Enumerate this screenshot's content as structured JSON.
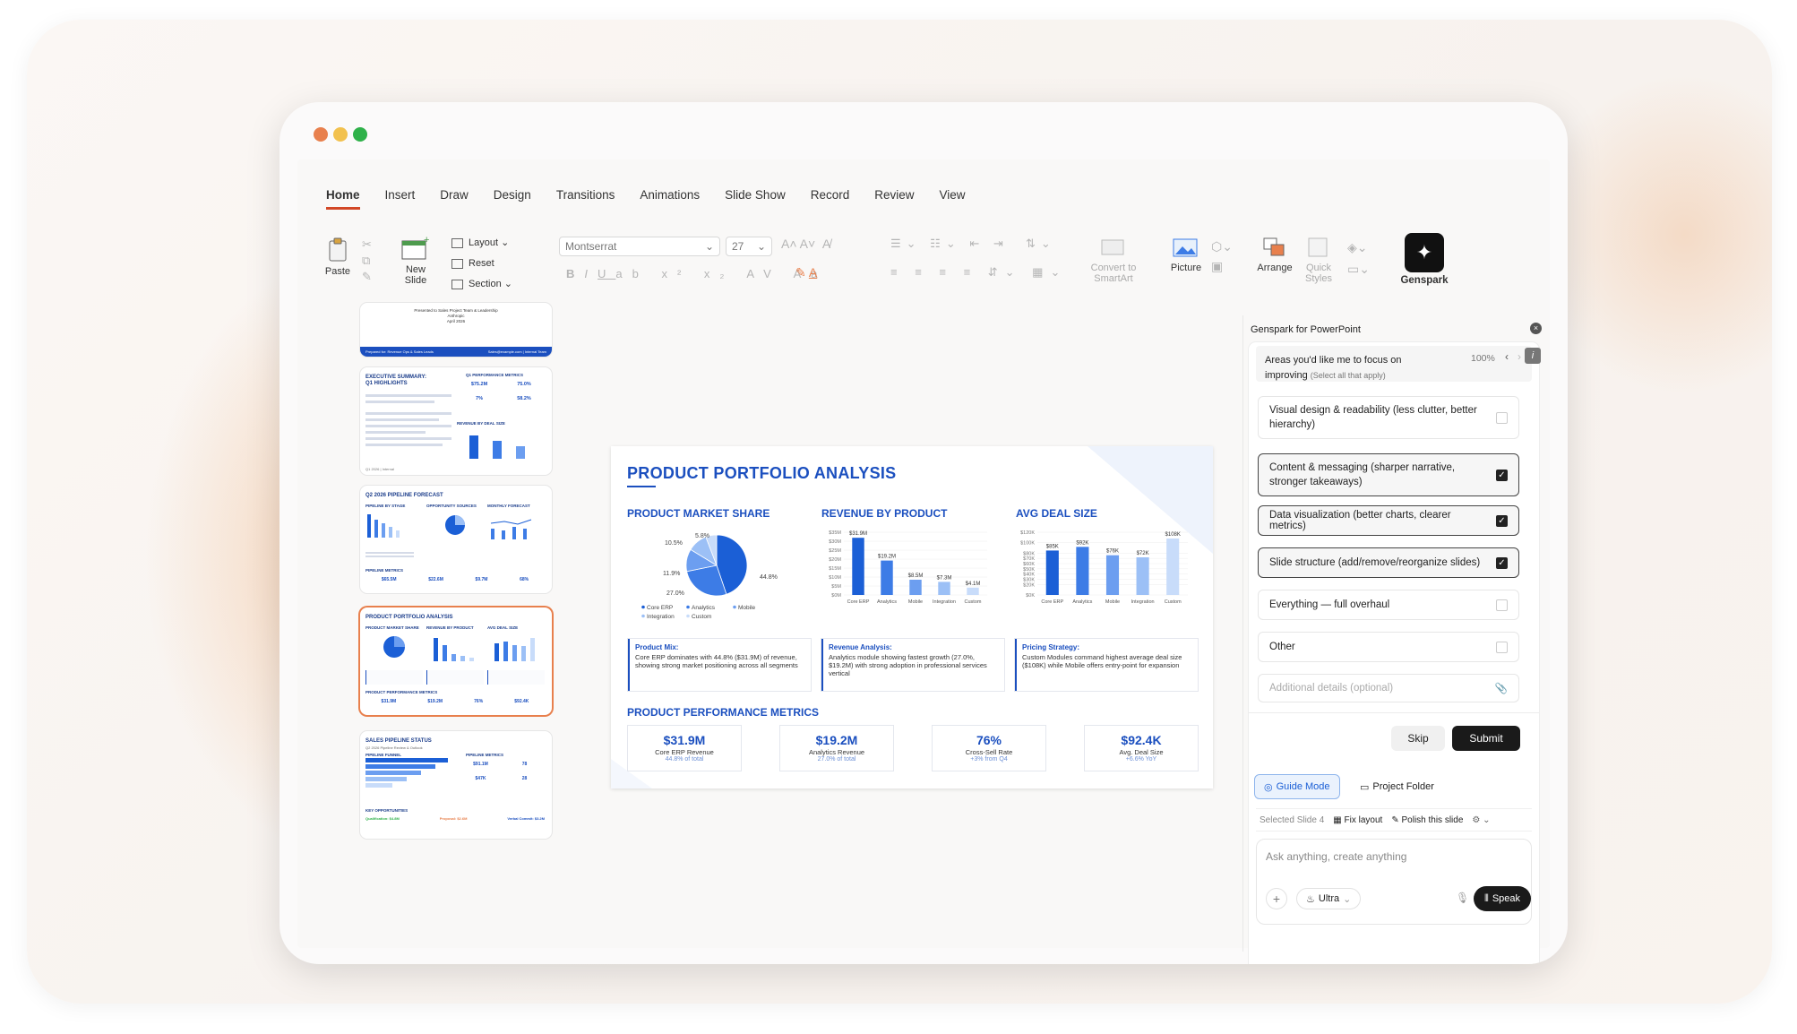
{
  "window": {
    "dots": [
      "#e8804d",
      "#f2c14e",
      "#2fb14a"
    ]
  },
  "tabs": [
    "Home",
    "Insert",
    "Draw",
    "Design",
    "Transitions",
    "Animations",
    "Slide Show",
    "Record",
    "Review",
    "View"
  ],
  "ribbon": {
    "paste": "Paste",
    "new_slide_1": "New",
    "new_slide_2": "Slide",
    "layout": "Layout",
    "reset": "Reset",
    "section": "Section",
    "font": "Montserrat",
    "size": "27",
    "convert_1": "Convert to",
    "convert_2": "SmartArt",
    "picture": "Picture",
    "arrange": "Arrange",
    "quick_1": "Quick",
    "quick_2": "Styles",
    "genspark": "Genspark"
  },
  "thumbs": {
    "t1": {
      "line1": "Presented to Sales Project Team & Leadership",
      "line2": "Anthropic",
      "line3": "April 2026",
      "footer_left": "Prepared for: Revenue Ops & Sales Leads",
      "footer_right": "Sales@example.com | Internal Team"
    },
    "t2": {
      "title1": "EXECUTIVE SUMMARY:",
      "title2": "Q1 HIGHLIGHTS",
      "side": "Q1 PERFORMANCE METRICS",
      "m1": "$75.2M",
      "m2": "75.0%",
      "m3": "7%",
      "m4": "58.2%",
      "chart": "REVENUE BY DEAL SIZE",
      "footer": "Q1 2026 | Internal"
    },
    "t3": {
      "title": "Q2 2026 PIPELINE FORECAST",
      "s1": "PIPELINE BY STAGE",
      "s2": "OPPORTUNITY SOURCES",
      "s3": "MONTHLY FORECAST",
      "metrics": "PIPELINE METRICS",
      "m1": "$65.5M",
      "m2": "$22.6M",
      "m3": "$9.7M",
      "m4": "68%"
    },
    "t4": {
      "title": "PRODUCT PORTFOLIO ANALYSIS",
      "s1": "PRODUCT MARKET SHARE",
      "s2": "REVENUE BY PRODUCT",
      "s3": "AVG DEAL SIZE",
      "metrics": "PRODUCT PERFORMANCE METRICS",
      "m1": "$31.9M",
      "m2": "$19.2M",
      "m3": "76%",
      "m4": "$92.4K"
    },
    "t5": {
      "title": "SALES PIPELINE STATUS",
      "sub": "Q2 2026 Pipeline Review & Outlook",
      "s1": "PIPELINE FUNNEL",
      "s2": "PIPELINE METRICS",
      "m1": "$91.1M",
      "m2": "78",
      "m3": "$47K",
      "m4": "28",
      "s3": "KEY OPPORTUNITIES",
      "k1": "Qualification: $4.8M",
      "k2": "Proposal: $2.6M",
      "k3": "Verbal Commit: $3.2M"
    }
  },
  "slide": {
    "title": "PRODUCT PORTFOLIO ANALYSIS",
    "sub1": "PRODUCT MARKET SHARE",
    "sub2": "REVENUE BY PRODUCT",
    "sub3": "AVG DEAL SIZE",
    "pie_labels": [
      "5.8%",
      "10.5%",
      "11.9%",
      "27.0%",
      "44.8%"
    ],
    "pie_legend": [
      "Core ERP",
      "Analytics",
      "Mobile",
      "Integration",
      "Custom"
    ],
    "card1_title": "Product Mix:",
    "card1_text": "Core ERP dominates with 44.8% ($31.9M) of revenue, showing strong market positioning across all segments",
    "card2_title": "Revenue Analysis:",
    "card2_text": "Analytics module showing fastest growth (27.0%, $19.2M) with strong adoption in professional services vertical",
    "card3_title": "Pricing Strategy:",
    "card3_text": "Custom Modules command highest average deal size ($108K) while Mobile offers entry-point for expansion",
    "metrics_title": "PRODUCT PERFORMANCE METRICS",
    "metrics": [
      {
        "value": "$31.9M",
        "label": "Core ERP Revenue",
        "sub": "44.8% of total"
      },
      {
        "value": "$19.2M",
        "label": "Analytics Revenue",
        "sub": "27.0% of total"
      },
      {
        "value": "76%",
        "label": "Cross-Sell Rate",
        "sub": "+3% from Q4"
      },
      {
        "value": "$92.4K",
        "label": "Avg. Deal Size",
        "sub": "+6.6% YoY"
      }
    ]
  },
  "chart_data": [
    {
      "type": "pie",
      "title": "PRODUCT MARKET SHARE",
      "categories": [
        "Core ERP",
        "Analytics",
        "Mobile",
        "Integration",
        "Custom"
      ],
      "values": [
        44.8,
        27.0,
        11.9,
        10.5,
        5.8
      ],
      "colors": [
        "#1b5fd6",
        "#3d7ce6",
        "#6c9ef0",
        "#9cc0f6",
        "#c8dcfa"
      ]
    },
    {
      "type": "bar",
      "title": "REVENUE BY PRODUCT",
      "categories": [
        "Core ERP",
        "Analytics",
        "Mobile",
        "Integration",
        "Custom"
      ],
      "values": [
        31.9,
        19.2,
        8.5,
        7.3,
        4.1
      ],
      "data_labels": [
        "$31.9M",
        "$19.2M",
        "$8.5M",
        "$7.3M",
        "$4.1M"
      ],
      "yticks": [
        "$0M",
        "$5M",
        "$10M",
        "$15M",
        "$20M",
        "$25M",
        "$30M",
        "$35M"
      ],
      "ylim": [
        0,
        35
      ],
      "colors": [
        "#1b5fd6",
        "#3d7ce6",
        "#6c9ef0",
        "#9cc0f6",
        "#c8dcfa"
      ]
    },
    {
      "type": "bar",
      "title": "AVG DEAL SIZE",
      "categories": [
        "Core ERP",
        "Analytics",
        "Mobile",
        "Integration",
        "Custom"
      ],
      "values": [
        85,
        92,
        76,
        72,
        108
      ],
      "data_labels": [
        "$85K",
        "$92K",
        "$76K",
        "$72K",
        "$108K"
      ],
      "yticks": [
        "$0K",
        "$20K",
        "$30K",
        "$40K",
        "$50K",
        "$60K",
        "$70K",
        "$80K",
        "$100K",
        "$120K"
      ],
      "ylim": [
        0,
        120
      ],
      "colors": [
        "#1b5fd6",
        "#3d7ce6",
        "#6c9ef0",
        "#9cc0f6",
        "#c8dcfa"
      ]
    }
  ],
  "panel": {
    "title": "Genspark for PowerPoint",
    "question": "Areas you'd like me to focus on improving",
    "hint": "(Select all that apply)",
    "zoom": "100%",
    "options": [
      {
        "label": "Visual design & readability (less clutter, better hierarchy)",
        "checked": false
      },
      {
        "label": "Content & messaging (sharper narrative, stronger takeaways)",
        "checked": true
      },
      {
        "label": "Data visualization (better charts, clearer metrics)",
        "checked": true
      },
      {
        "label": "Slide structure (add/remove/reorganize slides)",
        "checked": true
      },
      {
        "label": "Everything — full overhaul",
        "checked": false
      },
      {
        "label": "Other",
        "checked": false
      }
    ],
    "details_placeholder": "Additional details (optional)",
    "skip": "Skip",
    "submit": "Submit",
    "guide": "Guide Mode",
    "folder": "Project Folder",
    "selected": "Selected Slide 4",
    "fix": "Fix layout",
    "polish": "Polish this slide",
    "ask_placeholder": "Ask anything, create anything",
    "ultra": "Ultra",
    "speak": "Speak"
  }
}
